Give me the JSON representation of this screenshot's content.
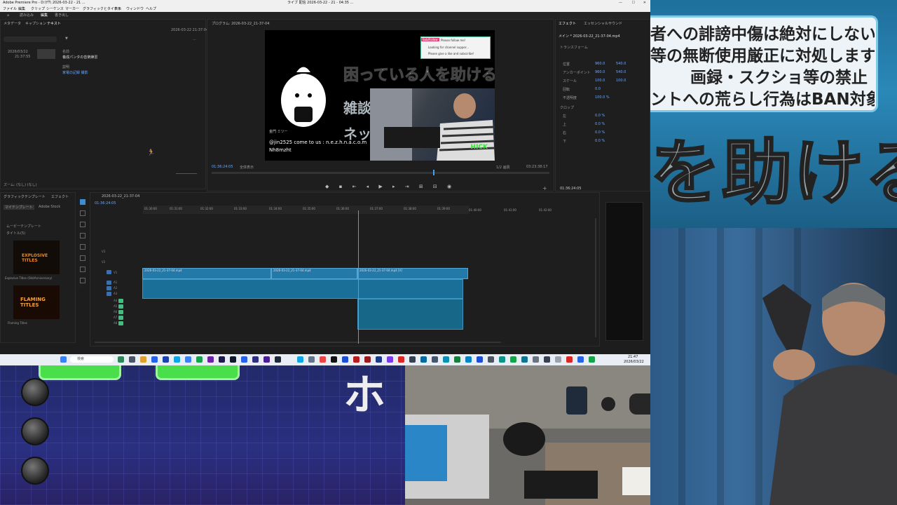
{
  "app": {
    "title_bar": "Adobe Premiere Pro - D:\\YT\\ 2026-03-22 - 21 ...",
    "window_title": "ライブ 配信 2026-03-22 - 21 - 04:35 ...",
    "menu": [
      "ファイル",
      "編集",
      "クリップ",
      "シーケンス",
      "マーカー",
      "グラフィックとタイトル",
      "表示",
      "ウィンドウ",
      "ヘルプ"
    ],
    "workspace_tabs": [
      "読み込み",
      "編集",
      "書き出し"
    ]
  },
  "project_panel": {
    "tabs": [
      "メタデータ",
      "キャプション",
      "テキスト"
    ],
    "date": "2026-03-22 21:37:04",
    "item_date": "2026/03/22",
    "item_time": "21:37:55",
    "field1_label": "名前",
    "field1_value": "養成パンタの音楽練習",
    "field2_label": "説明",
    "field2_value": "家電の記録 撮影",
    "bottom_label": "ズーム: (なし) (なし)"
  },
  "program_monitor": {
    "tab": "プログラム: 2026-03-22_21-37-04",
    "video_title": "困っている人を助ける",
    "video_sub1": "雑談",
    "video_sub2": "ネッ",
    "chat_label": "Sub/Follow",
    "chat_text1": "Please follow me!",
    "chat_text2": "Looking for channel suppor...",
    "chat_text3": "Please give a like and subscribe!",
    "name_line": "金門 ミツー",
    "url_line": "@jin2525 come to us : n.e.z.h.n.a.c.o.m",
    "url_line2": "Nh8mzht",
    "cam_badge": "HICK",
    "timecode_left": "01:36:24:05",
    "fit_label": "全体表示",
    "quality": "1/2 画質",
    "timecode_right": "03:23:38:17"
  },
  "effect_controls": {
    "tabs": [
      "エフェクト",
      "エッセンシャルサウンド"
    ],
    "clip": "メイン * 2026-03-22_21-37-04.mp4",
    "section1": "トランスフォーム",
    "props": [
      {
        "label": "位置",
        "value": "960.0",
        "value2": "540.0"
      },
      {
        "label": "アンカーポイント",
        "value": "960.0",
        "value2": "540.0"
      },
      {
        "label": "スケール",
        "value": "100.0",
        "value2": "100.0"
      },
      {
        "label": "回転",
        "value": "0.0"
      },
      {
        "label": "不透明度",
        "value": "100.0 %"
      }
    ],
    "section2": "クロップ",
    "crop": [
      {
        "label": "左",
        "value": "0.0 %"
      },
      {
        "label": "上",
        "value": "0.0 %"
      },
      {
        "label": "右",
        "value": "0.0 %"
      },
      {
        "label": "下",
        "value": "0.0 %"
      }
    ],
    "bottom_timecode": "01:36:24:05"
  },
  "essential_graphics": {
    "tabs": [
      "グラフィックテンプレート",
      "エフェクト"
    ],
    "sub_tabs": [
      "マイテンプレート",
      "Adobe Stock"
    ],
    "filter1": "ムービーテンプレート",
    "filter2": "タイトル(5)",
    "thumb1_label": "Explosive Titles (Old/Anniversary)",
    "thumb1_text": "EXPLOSIVE TITLES",
    "thumb2_label": "Flaming Titles",
    "thumb2_text": "FLAMING TITLES"
  },
  "timeline": {
    "tab": "2026-03-22_21-37-04",
    "timecode": "01:36:24:05",
    "ruler": [
      "01:30:00",
      "01:31:00",
      "01:32:00",
      "01:33:00",
      "01:34:00",
      "01:35:00",
      "01:36:00",
      "01:37:00",
      "01:38:00",
      "01:39:00",
      "01:40:00",
      "01:41:00",
      "01:42:00"
    ],
    "clip1": "2026-03-22_21-37-04.mp4",
    "clip2": "2026-03-22_21-37-04.mp4",
    "clip3": "2026-03-22_21-37-04.mp4 [V]",
    "video_tracks": [
      "V3",
      "V2",
      "V1"
    ],
    "audio_tracks": [
      "A1",
      "A2",
      "A3",
      "A4",
      "A5",
      "A6",
      "A7",
      "A8"
    ]
  },
  "taskbar": {
    "search": "検索",
    "time": "21:47",
    "date": "2026/03/22"
  },
  "overlay": {
    "rules": [
      "者への誹謗中傷は絶対にしない事",
      "等の無断使用厳正に対処します",
      "画録・スクショ等の禁止",
      "ントへの荒らし行為はBAN対象"
    ],
    "big_text": "を助ける",
    "cursor_char": "ホ"
  },
  "colors": {
    "accent": "#3b8fd9",
    "clip_blue": "#2379a8",
    "track_green": "#40c080",
    "overlay_green": "#4ade4a"
  }
}
